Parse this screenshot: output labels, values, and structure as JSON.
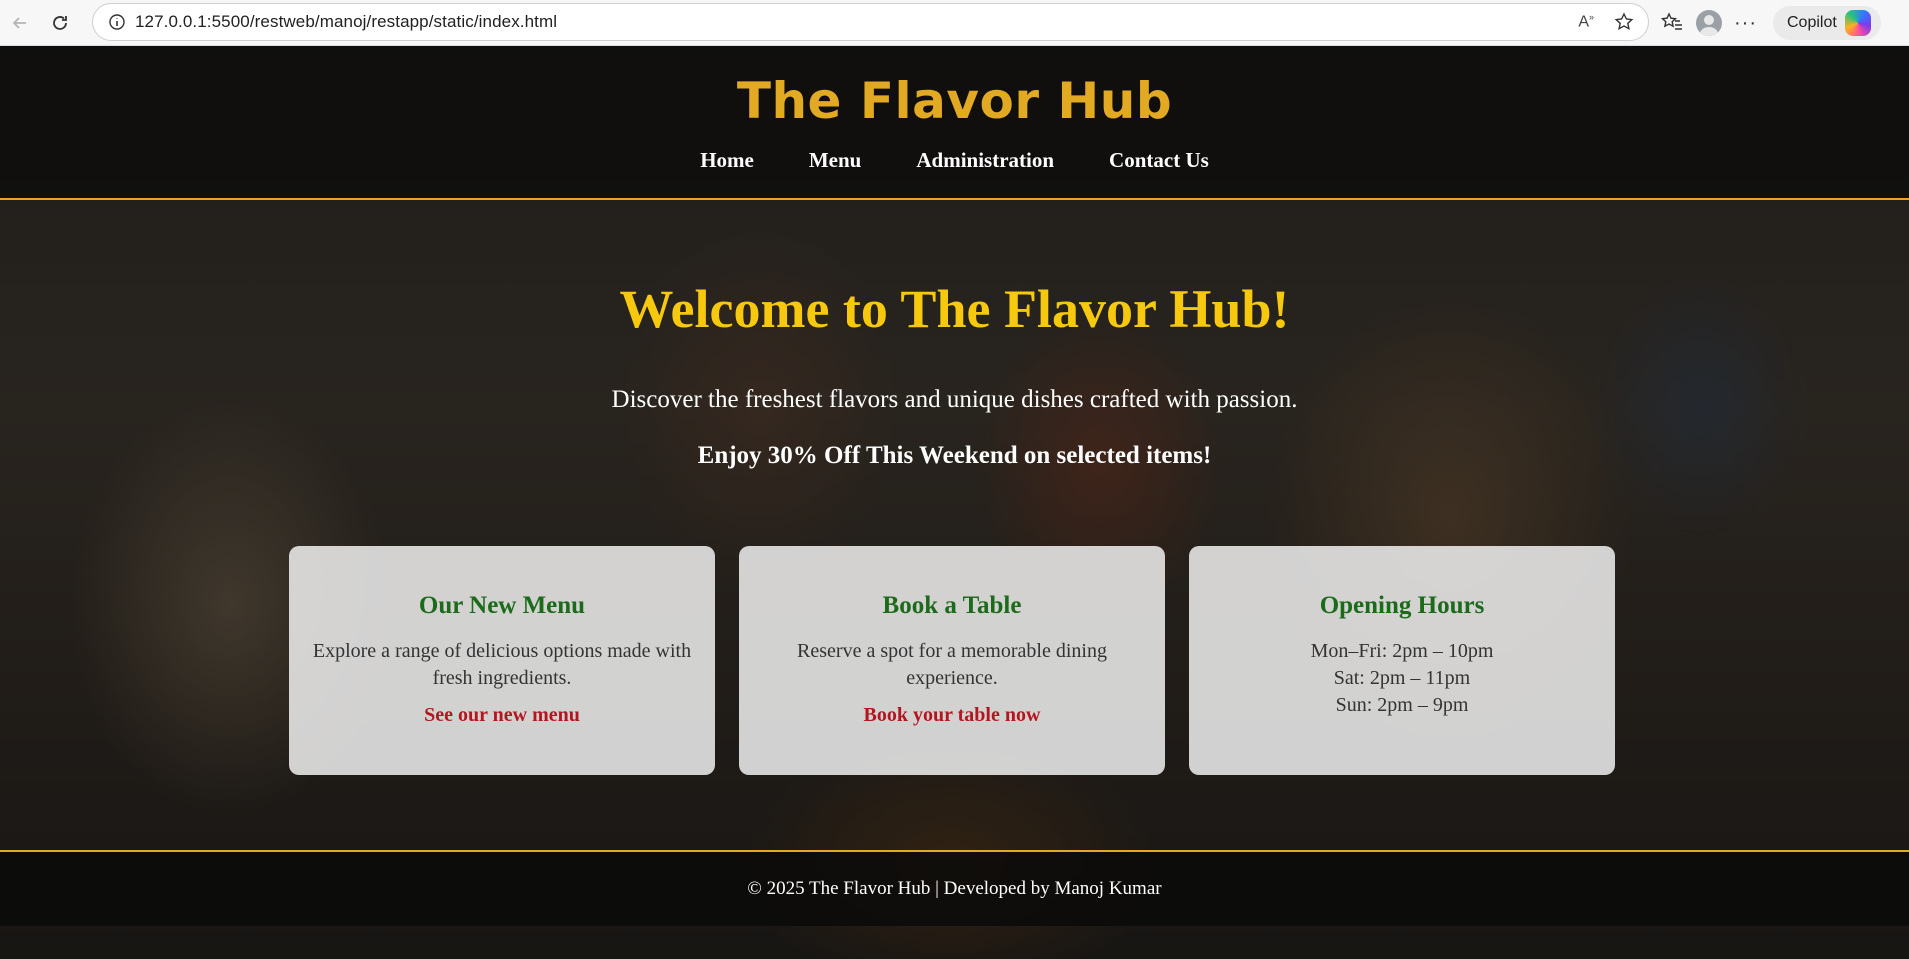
{
  "browser": {
    "url": "127.0.0.1:5500/restweb/manoj/restapp/static/index.html",
    "copilot_label": "Copilot"
  },
  "site": {
    "logo": "The Flavor Hub",
    "nav": [
      "Home",
      "Menu",
      "Administration",
      "Contact Us"
    ]
  },
  "hero": {
    "title": "Welcome to The Flavor Hub!",
    "subtitle": "Discover the freshest flavors and unique dishes crafted with passion.",
    "promo": "Enjoy 30% Off This Weekend on selected items!"
  },
  "cards": [
    {
      "title": "Our New Menu",
      "text": "Explore a range of delicious options made with fresh ingredients.",
      "link": "See our new menu"
    },
    {
      "title": "Book a Table",
      "text": "Reserve a spot for a memorable dining experience.",
      "link": "Book your table now"
    },
    {
      "title": "Opening Hours",
      "lines": [
        "Mon–Fri: 2pm – 10pm",
        "Sat: 2pm – 11pm",
        "Sun: 2pm – 9pm"
      ]
    }
  ],
  "footer": {
    "text": "© 2025 The Flavor Hub | Developed by Manoj Kumar"
  },
  "colors": {
    "accent": "#e2a922",
    "hero_title": "#f6c90e",
    "card_heading": "#1b6b1b",
    "card_link": "#b3161e"
  }
}
